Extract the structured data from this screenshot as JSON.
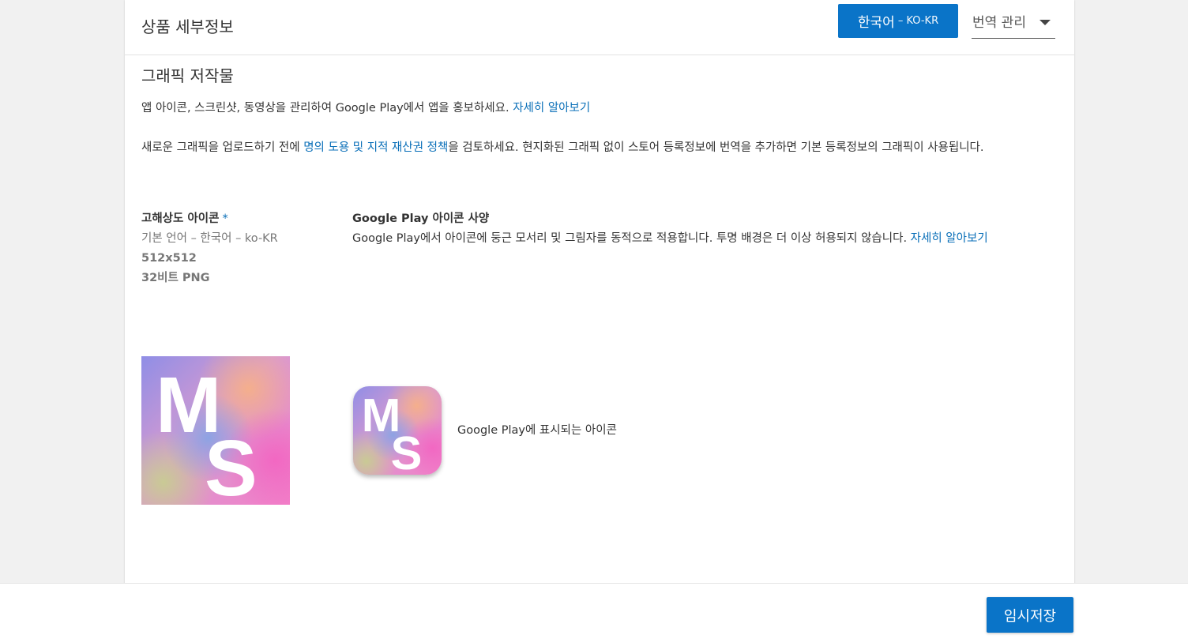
{
  "header": {
    "title": "상품 세부정보",
    "language_button": {
      "name": "한국어",
      "code": "– KO-KR"
    },
    "translate_dropdown": {
      "label": "번역 관리"
    }
  },
  "graphics": {
    "section_title": "그래픽 저작물",
    "intro": {
      "text": "앱 아이콘, 스크린샷, 동영상을 관리하여 Google Play에서 앱을 홍보하세요. ",
      "link": "자세히 알아보기"
    },
    "policy": {
      "before": "새로운 그래픽을 업로드하기 전에 ",
      "link": "명의 도용 및 지적 재산권 정책",
      "after": "을 검토하세요. 현지화된 그래픽 없이 스토어 등록정보에 번역을 추가하면 기본 등록정보의 그래픽이 사용됩니다."
    }
  },
  "icon_field": {
    "label": "고해상도 아이콘",
    "required_mark": "*",
    "language_note": "기본 언어 – 한국어 – ko-KR",
    "size": "512x512",
    "format": "32비트 PNG",
    "image_letters": [
      "M",
      "S"
    ]
  },
  "icon_spec": {
    "title": "Google Play 아이콘 사양",
    "text": "Google Play에서 아이콘에 둥근 모서리 및 그림자를 동적으로 적용합니다. 투명 배경은 더 이상 허용되지 않습니다. ",
    "link": "자세히 알아보기",
    "preview_caption": "Google Play에 표시되는 아이콘"
  },
  "footer": {
    "save_label": "임시저장"
  },
  "colors": {
    "accent": "#0a74c8",
    "link": "#0a6fb8"
  }
}
